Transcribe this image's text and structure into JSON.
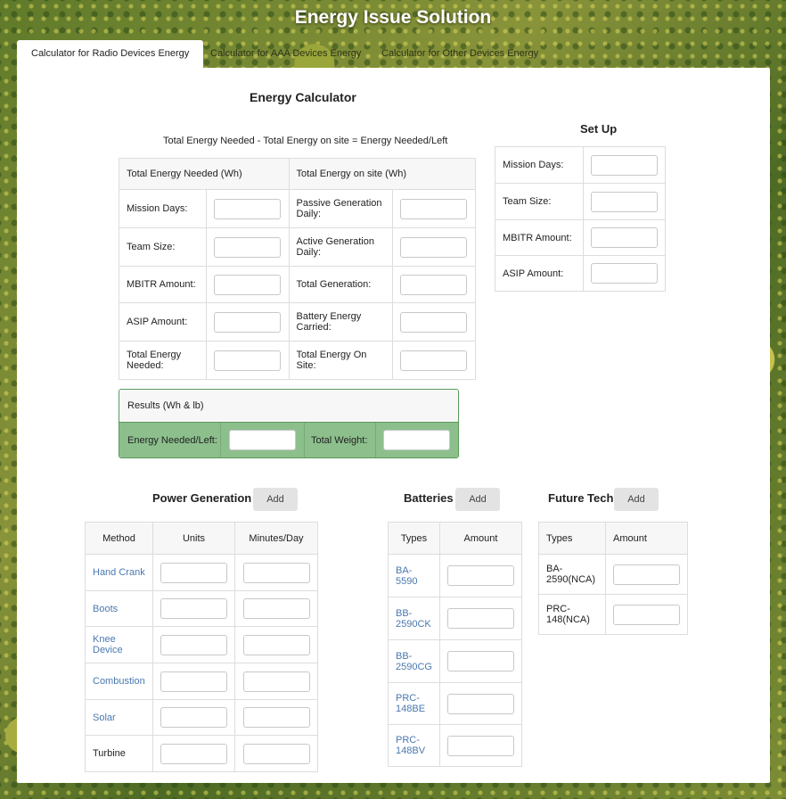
{
  "app_title": "Energy Issue Solution",
  "tabs": [
    {
      "label": "Calculator for Radio Devices Energy"
    },
    {
      "label": "Calculator for AAA Devices Energy"
    },
    {
      "label": "Calculator for Other Devices Energy"
    }
  ],
  "calculator": {
    "title": "Energy Calculator",
    "formula": "Total Energy Needed - Total Energy on site = Energy Needed/Left",
    "header_left": "Total Energy Needed (Wh)",
    "header_right": "Total Energy on site (Wh)",
    "left_rows": [
      "Mission Days:",
      "Team Size:",
      "MBITR Amount:",
      "ASIP Amount:",
      "Total Energy Needed:"
    ],
    "right_rows": [
      "Passive Generation Daily:",
      "Active Generation Daily:",
      "Total Generation:",
      "Battery Energy Carried:",
      "Total Energy On Site:"
    ]
  },
  "setup": {
    "title": "Set Up",
    "rows": [
      "Mission Days:",
      "Team Size:",
      "MBITR Amount:",
      "ASIP Amount:"
    ]
  },
  "results": {
    "header": "Results (Wh & lb)",
    "needed_label": "Energy Needed/Left:",
    "weight_label": "Total Weight:"
  },
  "power_generation": {
    "title": "Power Generation",
    "add_label": "Add",
    "columns": [
      "Method",
      "Units",
      "Minutes/Day"
    ],
    "methods": [
      "Hand Crank",
      "Boots",
      "Knee Device",
      "Combustion",
      "Solar",
      "Turbine"
    ]
  },
  "batteries": {
    "title": "Batteries",
    "add_label": "Add",
    "columns": [
      "Types",
      "Amount"
    ],
    "types": [
      "BA-\n5590",
      "BB-\n2590CK",
      "BB-\n2590CG",
      "PRC-\n148BE",
      "PRC-\n148BV"
    ]
  },
  "future_tech": {
    "title": "Future Tech",
    "add_label": "Add",
    "columns": [
      "Types",
      "Amount"
    ],
    "types": [
      "BA-\n2590(NCA)",
      "PRC-\n148(NCA)"
    ]
  },
  "colors": {
    "results_green": "#8cbf8c",
    "link_blue": "#4a78b0"
  }
}
